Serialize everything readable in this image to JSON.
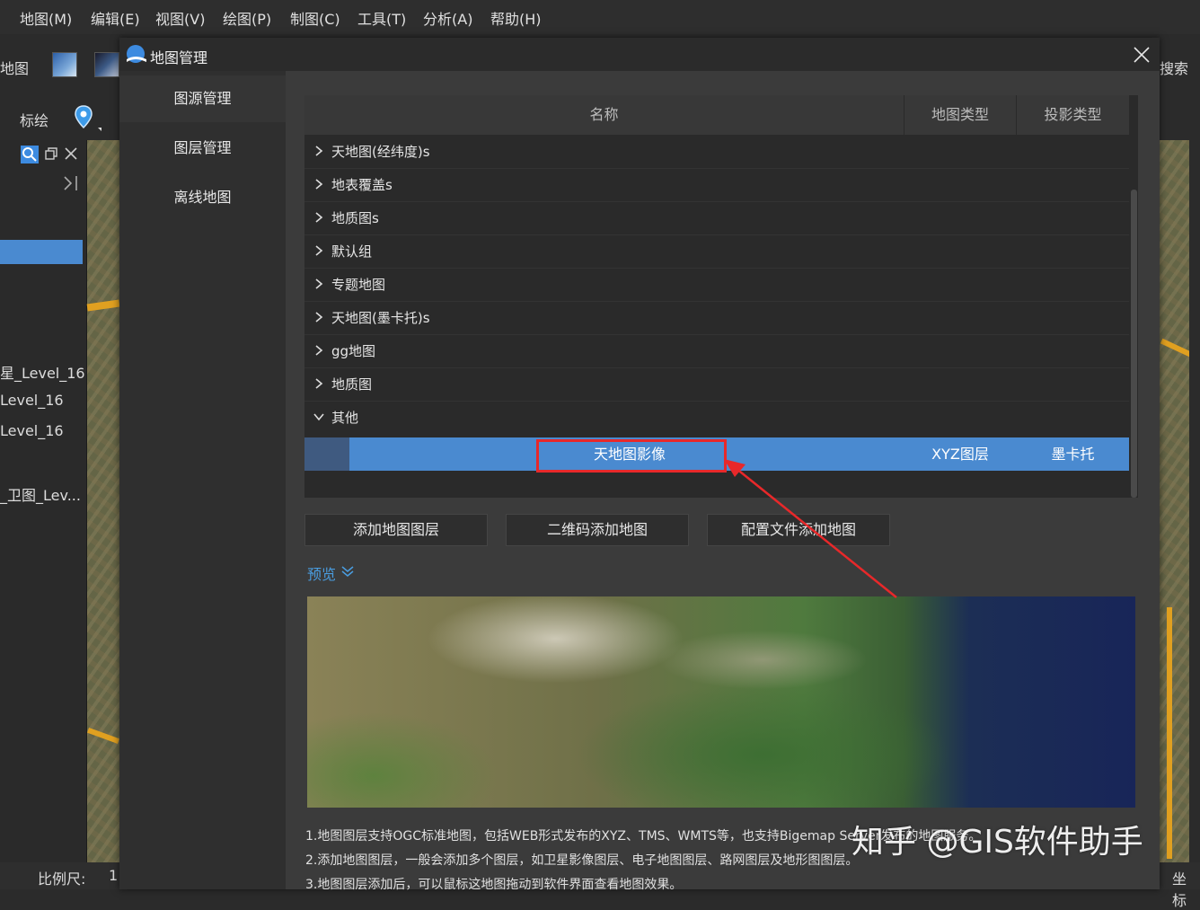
{
  "menu": [
    "地图(M)",
    "编辑(E)",
    "视图(V)",
    "绘图(P)",
    "制图(C)",
    "工具(T)",
    "分析(A)",
    "帮助(H)"
  ],
  "toolbar": {
    "map_label": "地图",
    "mark_label": "标绘",
    "search_label": "搜索"
  },
  "left_panel": {
    "items": [
      "星_Level_16",
      "Level_16",
      "Level_16",
      "_卫图_Lev..."
    ]
  },
  "status_bar": {
    "scale_label": "比例尺:",
    "scale_value": "1:",
    "coord_label": "坐标"
  },
  "dialog": {
    "title": "地图管理",
    "nav": [
      "图源管理",
      "图层管理",
      "离线地图"
    ],
    "table": {
      "headers": [
        "名称",
        "地图类型",
        "投影类型"
      ],
      "groups": [
        {
          "label": "天地图(经纬度)s",
          "expanded": false
        },
        {
          "label": "地表覆盖s",
          "expanded": false
        },
        {
          "label": "地质图s",
          "expanded": false
        },
        {
          "label": "默认组",
          "expanded": false
        },
        {
          "label": "专题地图",
          "expanded": false
        },
        {
          "label": "天地图(墨卡托)s",
          "expanded": false
        },
        {
          "label": "gg地图",
          "expanded": false
        },
        {
          "label": "地质图",
          "expanded": false
        },
        {
          "label": "其他",
          "expanded": true
        }
      ],
      "selected_row": {
        "name": "天地图影像",
        "map_type": "XYZ图层",
        "projection": "墨卡托"
      }
    },
    "buttons": {
      "add_layer": "添加地图图层",
      "qr_add": "二维码添加地图",
      "config_add": "配置文件添加地图"
    },
    "preview_label": "预览",
    "notes": [
      "1.地图图层支持OGC标准地图，包括WEB形式发布的XYZ、TMS、WMTS等，也支持Bigemap Server发布的地图服务。",
      "2.添加地图图层，一般会添加多个图层，如卫星影像图层、电子地图图层、路网图层及地形图图层。",
      "3.地图图层添加后，可以鼠标这地图拖动到软件界面查看地图效果。"
    ]
  },
  "watermark": "知乎 @GIS软件助手",
  "colors": {
    "selection": "#4a8ad0",
    "highlight_box": "#e8282a",
    "link": "#4a9de0"
  }
}
